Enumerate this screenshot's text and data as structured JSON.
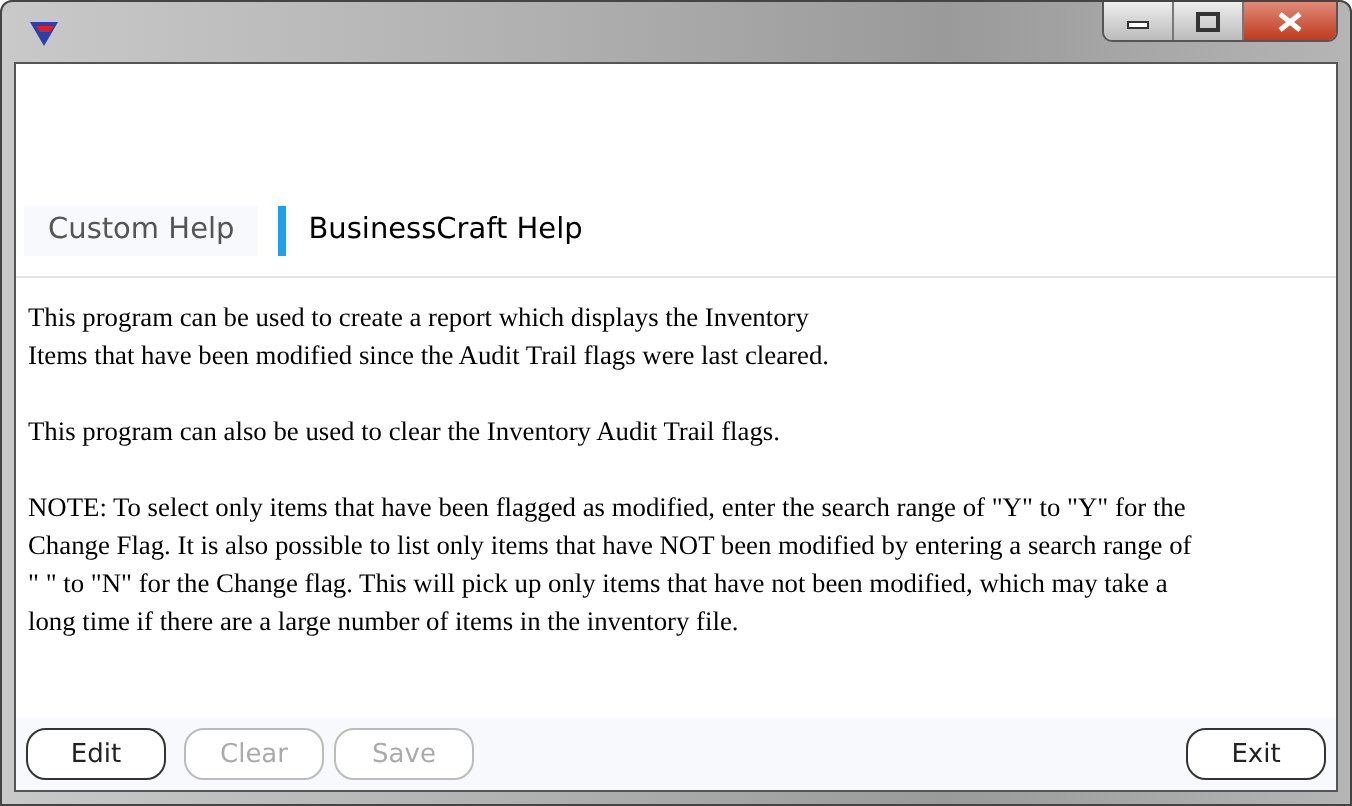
{
  "tabs": [
    {
      "label": "Custom Help",
      "selected": false
    },
    {
      "label": "BusinessCraft Help",
      "selected": true
    }
  ],
  "help_text": [
    [
      "This program can be used to create a report which displays the Inventory",
      "Items that have been modified since the Audit Trail flags were last cleared."
    ],
    [
      "This program can also be used to clear the Inventory Audit Trail flags."
    ],
    [
      "NOTE: To select only items that have been flagged as modified, enter the search range of \"Y\" to \"Y\" for the",
      "Change Flag. It is also possible to list only items that have NOT been modified by entering a search range of",
      "\" \" to \"N\" for the Change flag. This will pick up only items that have not been modified, which may take a",
      "long time if there are a large number of items in the inventory file."
    ]
  ],
  "buttons": [
    {
      "label": "Edit",
      "disabled": false
    },
    {
      "label": "Clear",
      "disabled": true
    },
    {
      "label": "Save",
      "disabled": true
    },
    {
      "label": "Exit",
      "disabled": false
    }
  ]
}
